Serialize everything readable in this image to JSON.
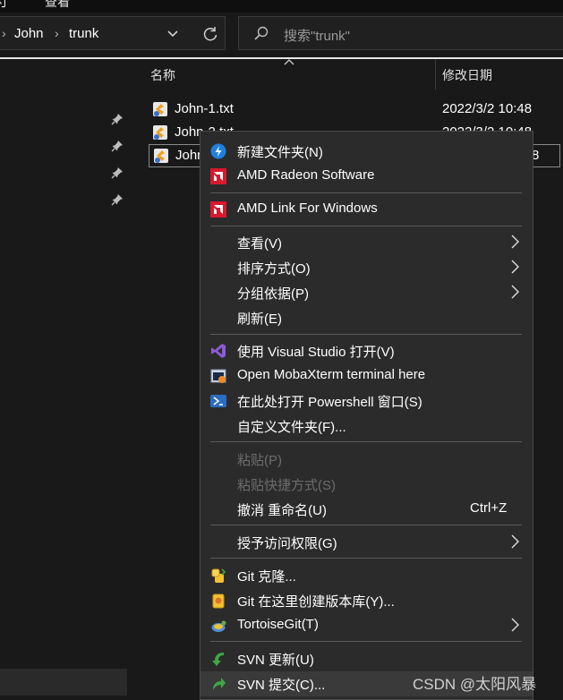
{
  "title_fragment": "查看",
  "address": {
    "crumbs": [
      "John",
      "trunk"
    ],
    "search_placeholder": "搜索\"trunk\""
  },
  "columns": {
    "name": "名称",
    "modified": "修改日期"
  },
  "files": [
    {
      "name": "John-1.txt",
      "date": "2022/3/2 10:48"
    },
    {
      "name": "John-2.txt",
      "date": "2022/3/2 10:48"
    },
    {
      "name": "John",
      "date": "8"
    }
  ],
  "context_menu": {
    "items": [
      {
        "label": "新建文件夹(N)",
        "icon": "new-folder-icon"
      },
      {
        "label": "AMD Radeon Software",
        "icon": "amd-icon"
      },
      {
        "label": "AMD Link For Windows",
        "icon": "amd-icon"
      },
      {
        "label": "查看(V)",
        "submenu": true
      },
      {
        "label": "排序方式(O)",
        "submenu": true
      },
      {
        "label": "分组依据(P)",
        "submenu": true
      },
      {
        "label": "刷新(E)"
      },
      {
        "label": "使用 Visual Studio 打开(V)",
        "icon": "visual-studio-icon"
      },
      {
        "label": "Open MobaXterm terminal here",
        "icon": "mobaxterm-icon"
      },
      {
        "label": "在此处打开 Powershell 窗口(S)",
        "icon": "powershell-icon"
      },
      {
        "label": "自定义文件夹(F)..."
      },
      {
        "label": "粘贴(P)",
        "disabled": true
      },
      {
        "label": "粘贴快捷方式(S)",
        "disabled": true
      },
      {
        "label": "撤消 重命名(U)",
        "shortcut": "Ctrl+Z"
      },
      {
        "label": "授予访问权限(G)",
        "submenu": true
      },
      {
        "label": "Git 克隆...",
        "icon": "git-clone-icon"
      },
      {
        "label": "Git 在这里创建版本库(Y)...",
        "icon": "git-create-repo-icon"
      },
      {
        "label": "TortoiseGit(T)",
        "icon": "tortoisegit-icon",
        "submenu": true
      },
      {
        "label": "SVN 更新(U)",
        "icon": "svn-update-icon"
      },
      {
        "label": "SVN 提交(C)...",
        "icon": "svn-commit-icon"
      }
    ]
  },
  "watermark": "CSDN @太阳风暴",
  "colors": {
    "background": "#191919",
    "menu_bg": "#2b2b2b",
    "amd_red": "#d9182d",
    "svn_green": "#3fa845"
  }
}
